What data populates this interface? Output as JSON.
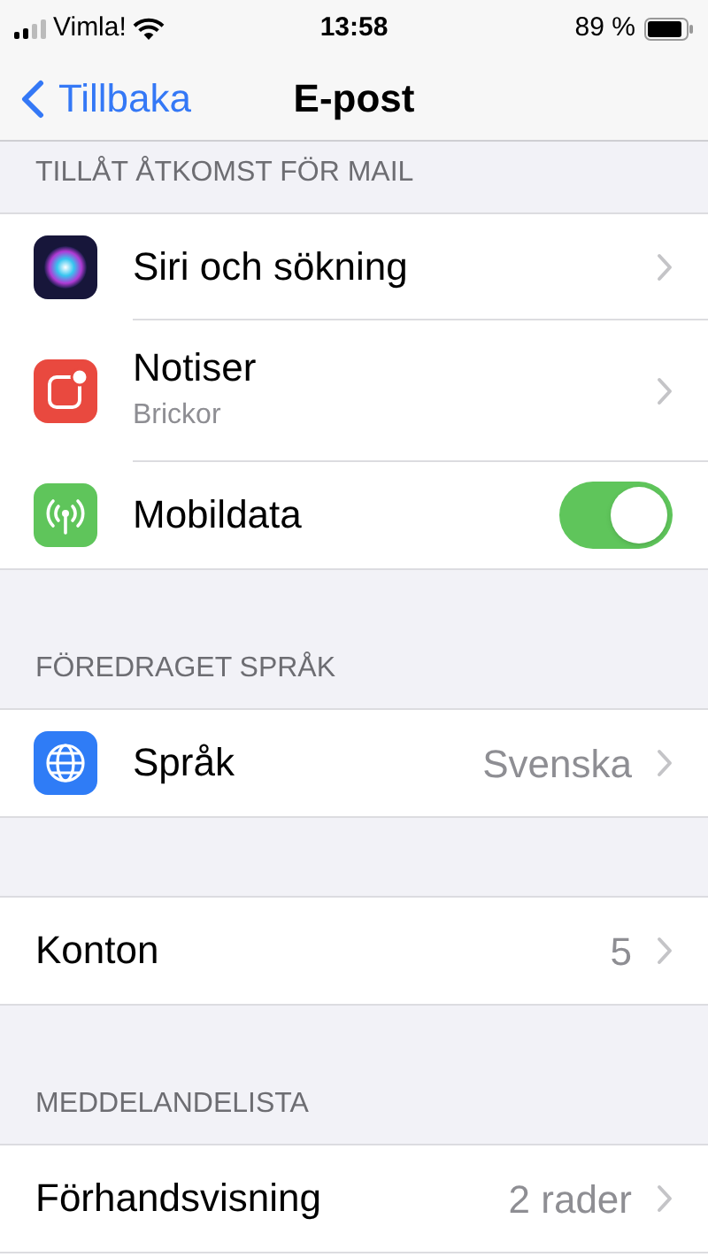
{
  "status_bar": {
    "carrier": "Vimla!",
    "time": "13:58",
    "battery": "89 %"
  },
  "nav": {
    "back": "Tillbaka",
    "title": "E-post"
  },
  "sections": [
    {
      "header": "TILLÅT ÅTKOMST FÖR MAIL",
      "rows": [
        {
          "kind": "nav",
          "label": "Siri och sökning"
        },
        {
          "kind": "nav",
          "label": "Notiser",
          "subtitle": "Brickor"
        },
        {
          "kind": "toggle",
          "label": "Mobildata",
          "on": true
        }
      ]
    },
    {
      "header": "FÖREDRAGET SPRÅK",
      "rows": [
        {
          "kind": "nav",
          "label": "Språk",
          "value": "Svenska"
        }
      ]
    },
    {
      "rows": [
        {
          "kind": "nav",
          "label": "Konton",
          "value": "5"
        }
      ]
    },
    {
      "header": "MEDDELANDELISTA",
      "rows": [
        {
          "kind": "nav",
          "label": "Förhandsvisning",
          "value": "2 rader"
        }
      ]
    }
  ]
}
